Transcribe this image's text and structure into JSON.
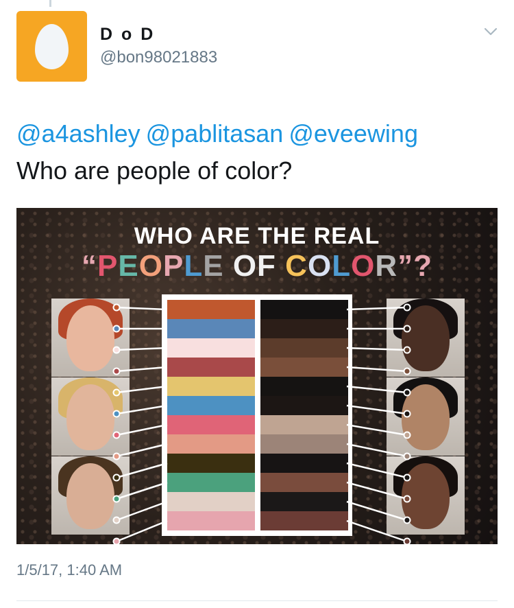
{
  "tweet": {
    "display_name": "D o D",
    "handle": "@bon98021883",
    "mentions": [
      "@a4ashley",
      "@pablitasan",
      "@eveewing"
    ],
    "text": "Who are people of color?",
    "timestamp": "1/5/17, 1:40 AM"
  },
  "colors": {
    "avatar_bg": "#f6a623",
    "link": "#1b95e0",
    "muted": "#657786"
  },
  "icons": {
    "avatar": "default-egg-icon",
    "menu": "chevron-down-icon"
  },
  "infographic": {
    "title_line1": "WHO ARE THE REAL",
    "title_line2_parts": [
      {
        "text": "“",
        "color": "#e6a7b0"
      },
      {
        "text": "P",
        "color": "#e2566e"
      },
      {
        "text": "E",
        "color": "#66b8a8"
      },
      {
        "text": "O",
        "color": "#f2a07b"
      },
      {
        "text": "P",
        "color": "#e6a7b0"
      },
      {
        "text": "L",
        "color": "#4f9bd1"
      },
      {
        "text": "E",
        "color": "#a3a3a3"
      },
      {
        "text": " ",
        "color": "#ffffff"
      },
      {
        "text": "O",
        "color": "#f1f1f1"
      },
      {
        "text": "F",
        "color": "#f1f1f1"
      },
      {
        "text": " ",
        "color": "#ffffff"
      },
      {
        "text": "C",
        "color": "#f6c25a"
      },
      {
        "text": "O",
        "color": "#d9e1f2"
      },
      {
        "text": "L",
        "color": "#4f9bd1"
      },
      {
        "text": "O",
        "color": "#e2566e"
      },
      {
        "text": "R",
        "color": "#b9b9b9"
      },
      {
        "text": "”?",
        "color": "#e6a7b0"
      }
    ],
    "left_swatches": [
      "#c0582e",
      "#5a87b8",
      "#f8dfdf",
      "#a9494a",
      "#e4c56e",
      "#4d91c2",
      "#e06477",
      "#e39a85",
      "#3a2f10",
      "#4ba17d",
      "#e2d0c6",
      "#e6a5ae"
    ],
    "right_swatches": [
      "#141212",
      "#2c1e18",
      "#5c3c2b",
      "#7a4f3a",
      "#151312",
      "#1c1614",
      "#bfa492",
      "#9c8478",
      "#171414",
      "#7a4c3d",
      "#1b1818",
      "#6b3c35"
    ],
    "left_people": [
      {
        "name": "redhead-woman",
        "skin": "#e8b79e",
        "hair": "#b5482a"
      },
      {
        "name": "blond-man",
        "skin": "#e1b59b",
        "hair": "#d8b46a"
      },
      {
        "name": "brunette-woman",
        "skin": "#d9ae95",
        "hair": "#4a3420"
      }
    ],
    "right_people": [
      {
        "name": "african-woman",
        "skin": "#4a2f24",
        "hair": "#151010"
      },
      {
        "name": "asian-man",
        "skin": "#b08466",
        "hair": "#121010"
      },
      {
        "name": "south-asian-woman",
        "skin": "#6e4432",
        "hair": "#150f0d"
      }
    ]
  }
}
